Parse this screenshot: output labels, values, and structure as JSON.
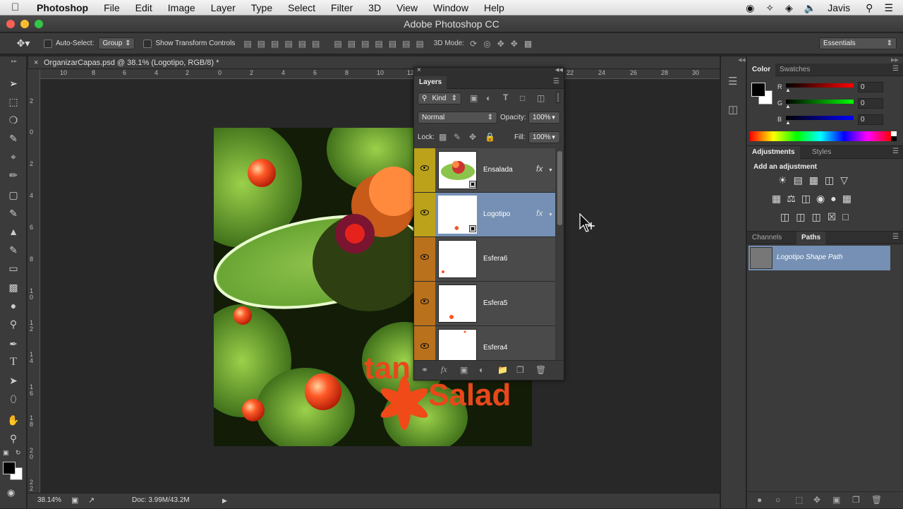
{
  "menubar": {
    "app": "Photoshop",
    "items": [
      "File",
      "Edit",
      "Image",
      "Layer",
      "Type",
      "Select",
      "Filter",
      "3D",
      "View",
      "Window",
      "Help"
    ],
    "user": "Javis"
  },
  "window": {
    "title": "Adobe Photoshop CC"
  },
  "options": {
    "auto_select_label": "Auto-Select:",
    "auto_select_value": "Group",
    "transform_label": "Show Transform Controls",
    "mode3d_label": "3D Mode:",
    "workspace": "Essentials"
  },
  "document": {
    "tab_title": "OrganizarCapas.psd @ 38.1% (Logotipo, RGB/8) *",
    "zoom": "38.14%",
    "doc_size": "Doc: 3.99M/43.2M",
    "ruler_top": [
      "10",
      "8",
      "6",
      "4",
      "2",
      "0",
      "2",
      "4",
      "6",
      "8",
      "10",
      "12",
      "22",
      "24",
      "26",
      "28",
      "30"
    ],
    "ruler_left": [
      "2",
      "0",
      "2",
      "4",
      "6",
      "8",
      "1\n0",
      "1\n2",
      "1\n4",
      "1\n6",
      "1\n8",
      "2\n0",
      "2\n2"
    ],
    "art_text_1": "tan",
    "art_text_2": "Salad"
  },
  "layers": {
    "title": "Layers",
    "filter": "Kind",
    "blend_mode": "Normal",
    "opacity_label": "Opacity:",
    "opacity": "100%",
    "lock_label": "Lock:",
    "fill_label": "Fill:",
    "fill": "100%",
    "items": [
      {
        "name": "Ensalada",
        "fx": "fx",
        "color": "#bca21a"
      },
      {
        "name": "Logotipo",
        "fx": "fx",
        "color": "#bca21a"
      },
      {
        "name": "Esfera6",
        "fx": "",
        "color": "#b9711c"
      },
      {
        "name": "Esfera5",
        "fx": "",
        "color": "#b9711c"
      },
      {
        "name": "Esfera4",
        "fx": "",
        "color": "#b9711c"
      }
    ]
  },
  "color_panel": {
    "tabs": [
      "Color",
      "Swatches"
    ],
    "labels": [
      "R",
      "G",
      "B"
    ],
    "values": [
      "0",
      "0",
      "0"
    ]
  },
  "adjustments_panel": {
    "tabs": [
      "Adjustments",
      "Styles"
    ],
    "heading": "Add an adjustment"
  },
  "paths_panel": {
    "tabs": [
      "Channels",
      "Paths"
    ],
    "path_name": "Logotipo Shape Path"
  }
}
